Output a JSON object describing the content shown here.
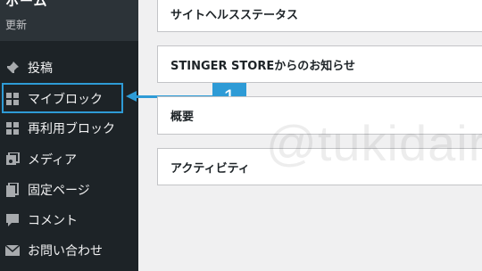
{
  "sidebar": {
    "home_title": "ホーム",
    "home_sub": "更新",
    "items": [
      {
        "label": "投稿",
        "icon": "pin-icon"
      },
      {
        "label": "マイブロック",
        "icon": "grid-icon"
      },
      {
        "label": "再利用ブロック",
        "icon": "grid-icon"
      },
      {
        "label": "メディア",
        "icon": "media-icon"
      },
      {
        "label": "固定ページ",
        "icon": "pages-icon"
      },
      {
        "label": "コメント",
        "icon": "comment-icon"
      },
      {
        "label": "お問い合わせ",
        "icon": "mail-icon"
      }
    ]
  },
  "callout": {
    "number": "1",
    "color": "#2e9bd6"
  },
  "panels": [
    {
      "title": "サイトヘルスステータス"
    },
    {
      "title": "STINGER STOREからのお知らせ"
    },
    {
      "title": "概要"
    },
    {
      "title": "アクティビティ"
    }
  ],
  "watermark": "@tukidaira"
}
